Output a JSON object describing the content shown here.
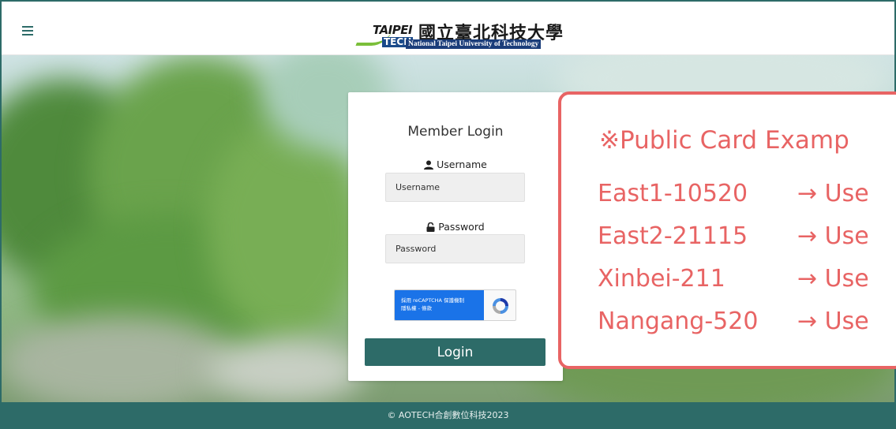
{
  "header": {
    "menu_icon": "hamburger-menu-icon",
    "logo": {
      "taipei": "TAIPEI",
      "tech": "TECH",
      "chinese_name": "國立臺北科技大學",
      "english_name": "National Taipei University of Technology"
    }
  },
  "login": {
    "title": "Member Login",
    "username_label": "Username",
    "username_placeholder": "Username",
    "password_label": "Password",
    "password_placeholder": "Password",
    "recaptcha_line1": "採用 reCAPTCHA 保護機制",
    "recaptcha_line2": "隱私權 - 條款",
    "login_button": "Login"
  },
  "notice": {
    "title": "※Public Card Examp",
    "rows": [
      {
        "code": "East1-10520",
        "arrow": "→ Use"
      },
      {
        "code": "East2-21115",
        "arrow": "→ Use"
      },
      {
        "code": "Xinbei-211",
        "arrow": "→ Use"
      },
      {
        "code": "Nangang-520",
        "arrow": "→ Use"
      }
    ]
  },
  "footer": {
    "copyright": "© AOTECH合創數位科技2023"
  },
  "colors": {
    "primary": "#2d6b68",
    "accent": "#e86464"
  }
}
